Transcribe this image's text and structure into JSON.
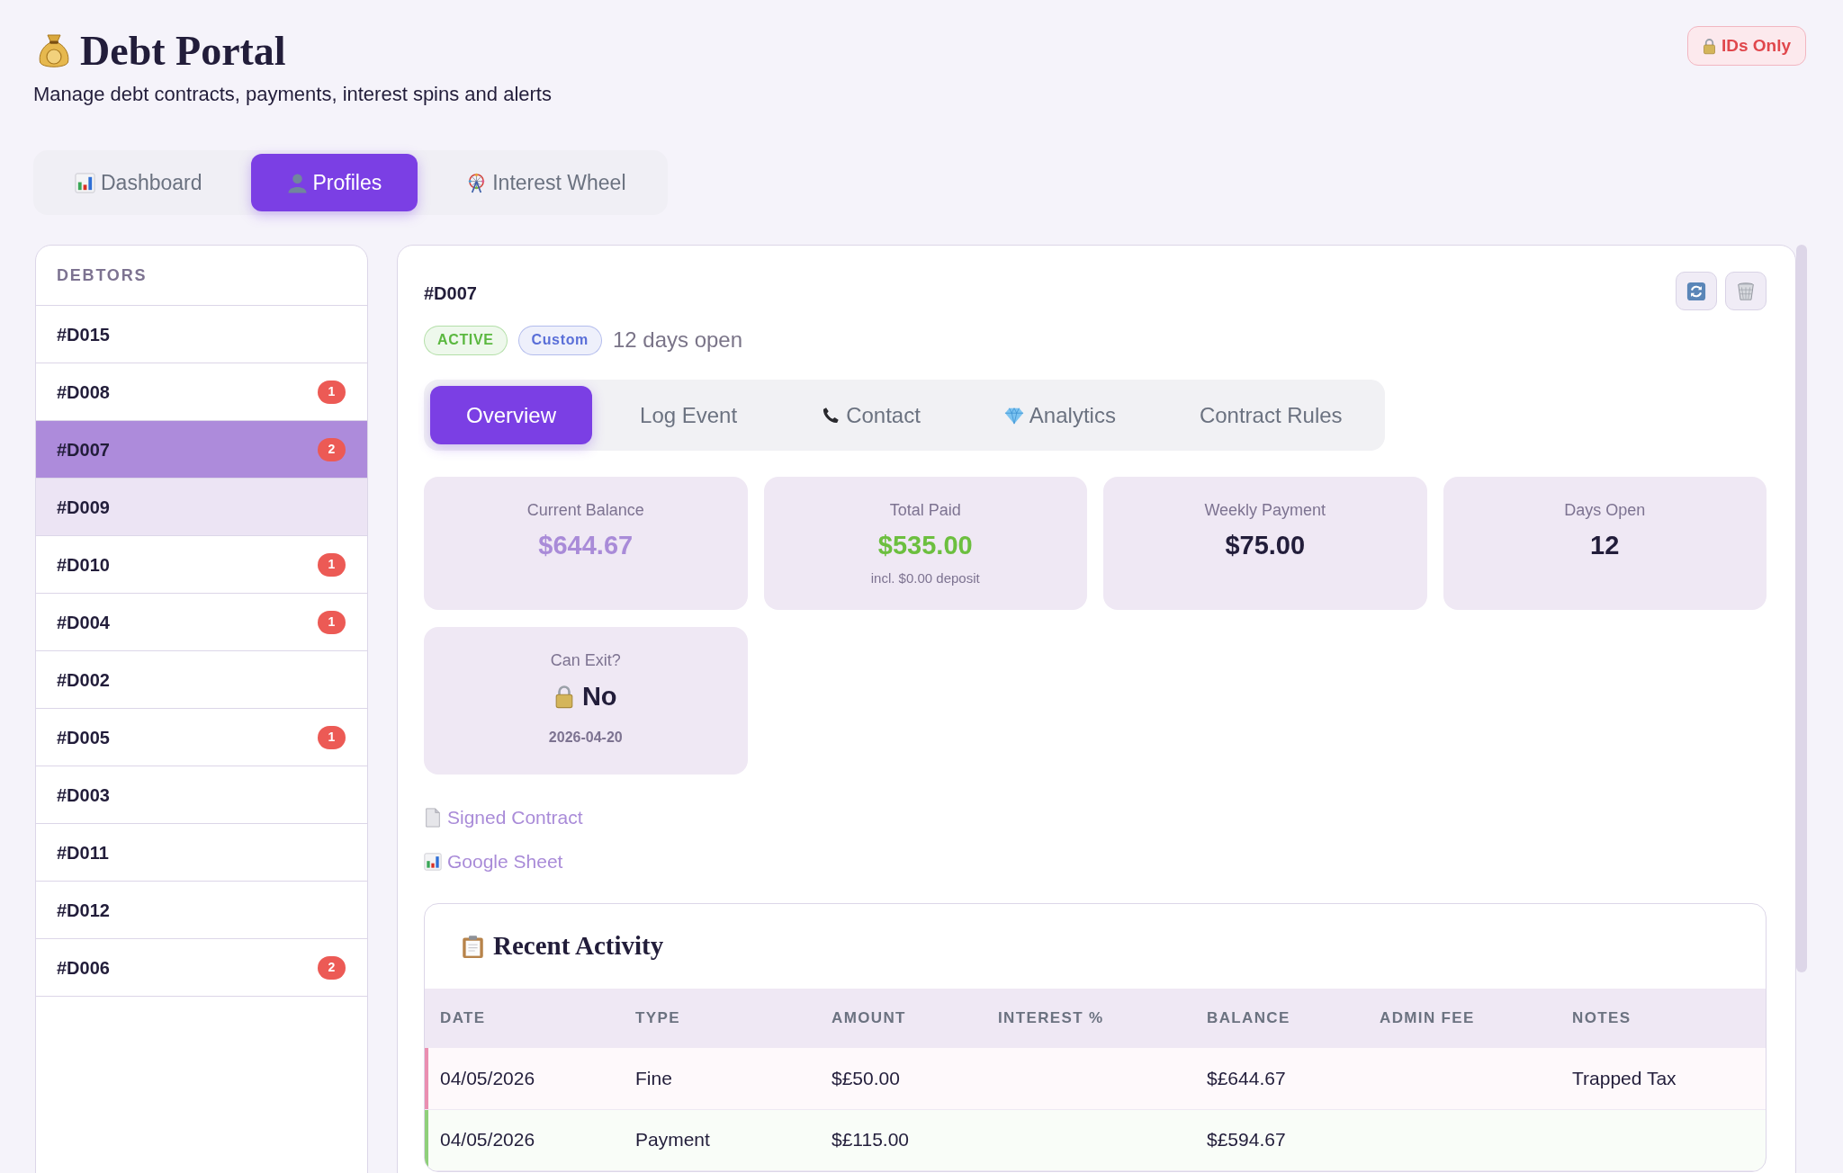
{
  "header": {
    "title": "Debt Portal",
    "subtitle": "Manage debt contracts, payments, interest spins and alerts",
    "mode_badge": "IDs Only"
  },
  "tabs": [
    {
      "label": "Dashboard",
      "selected": false
    },
    {
      "label": "Profiles",
      "selected": true
    },
    {
      "label": "Interest Wheel",
      "selected": false
    }
  ],
  "sidebar": {
    "heading": "DEBTORS",
    "items": [
      {
        "label": "#D015",
        "selected": false,
        "hovered": false
      },
      {
        "label": "#D008",
        "badge": "1",
        "selected": false,
        "hovered": false
      },
      {
        "label": "#D007",
        "badge": "2",
        "selected": true,
        "hovered": false
      },
      {
        "label": "#D009",
        "selected": false,
        "hovered": true
      },
      {
        "label": "#D010",
        "badge": "1",
        "selected": false,
        "hovered": false
      },
      {
        "label": "#D004",
        "badge": "1",
        "selected": false,
        "hovered": false
      },
      {
        "label": "#D002",
        "selected": false,
        "hovered": false
      },
      {
        "label": "#D005",
        "badge": "1",
        "selected": false,
        "hovered": false
      },
      {
        "label": "#D003",
        "selected": false,
        "hovered": false
      },
      {
        "label": "#D011",
        "selected": false,
        "hovered": false
      },
      {
        "label": "#D012",
        "selected": false,
        "hovered": false
      },
      {
        "label": "#D006",
        "badge": "2",
        "selected": false,
        "hovered": false
      }
    ]
  },
  "detail": {
    "title": "#D007",
    "tags": [
      {
        "text": "ACTIVE",
        "color": "#5bb840"
      },
      {
        "text": "Custom",
        "color": "#5a6fd8"
      }
    ],
    "age": "12 days open",
    "tabs": [
      {
        "label": "Overview",
        "selected": true
      },
      {
        "label": "Log Event",
        "selected": false
      },
      {
        "label": "Contact",
        "selected": false
      },
      {
        "label": "Analytics",
        "selected": false
      },
      {
        "label": "Contract Rules",
        "selected": false
      }
    ],
    "stats": [
      {
        "label": "Current Balance",
        "value": "$644.67",
        "color": "#a98bd8"
      },
      {
        "label": "Total Paid",
        "value": "$535.00",
        "note": "incl. $0.00 deposit",
        "color": "#6cbf3f"
      },
      {
        "label": "Weekly Payment",
        "value": "$75.00",
        "color": "#221d3a"
      },
      {
        "label": "Days Open",
        "value": "12",
        "color": "#221d3a"
      }
    ],
    "exit": {
      "label": "Can Exit?",
      "value": "No",
      "date": "2026-04-20"
    },
    "links": [
      {
        "label": "Signed Contract"
      },
      {
        "label": "Google Sheet"
      }
    ],
    "activity": {
      "title": "Recent Activity",
      "columns": [
        "DATE",
        "TYPE",
        "AMOUNT",
        "INTEREST %",
        "BALANCE",
        "ADMIN FEE",
        "NOTES"
      ],
      "rows": [
        {
          "color": "#ea8fb1",
          "cells": [
            "04/05/2026",
            "Fine",
            "$£50.00",
            null,
            "$£644.67",
            null,
            "Trapped Tax"
          ]
        },
        {
          "color": "#8fcf7a",
          "cells": [
            "04/05/2026",
            "Payment",
            "$£115.00",
            null,
            "$£594.67",
            null,
            null
          ]
        }
      ]
    }
  }
}
